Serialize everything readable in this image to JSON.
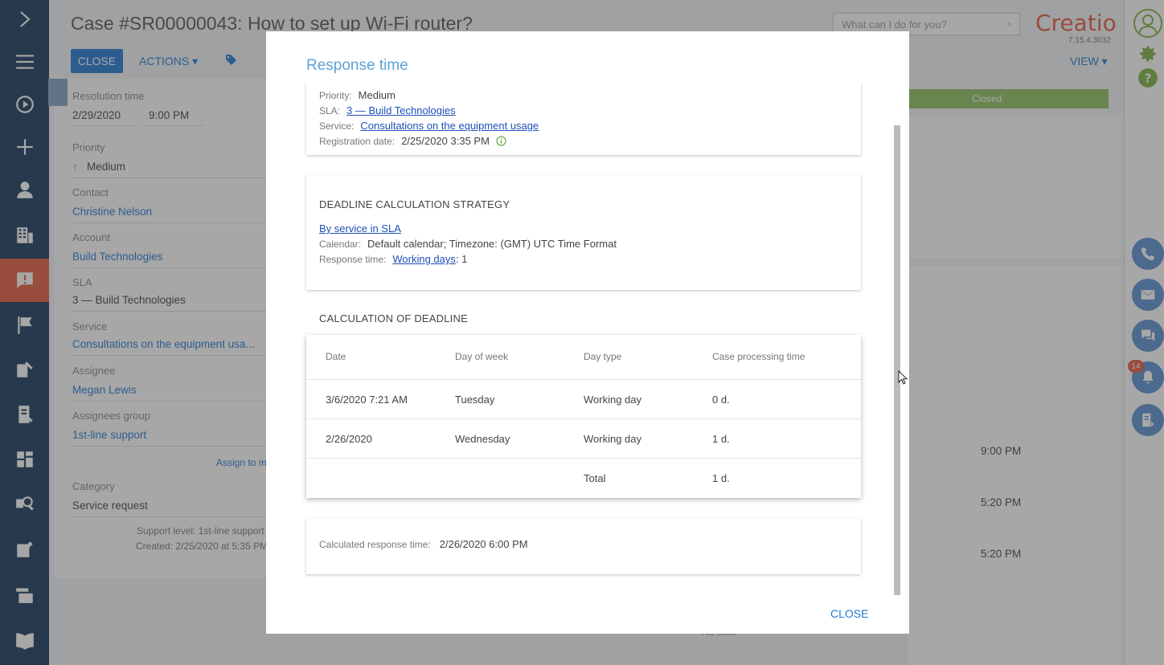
{
  "page": {
    "title": "Case #SR00000043: How to set up Wi-Fi router?",
    "close_label": "CLOSE",
    "actions_label": "ACTIONS",
    "view_label": "VIEW",
    "search_placeholder": "What can I do for you?",
    "logo": "Creatio",
    "version": "7.15.4.3032",
    "stage": "Closed",
    "assign_to_me": "Assign to me",
    "support_level": "Support level: 1st-line support",
    "created": "Created: 2/25/2020 at 5:35 PM",
    "bg_times": [
      "9:00 PM",
      "5:20 PM",
      "5:20 PM"
    ],
    "no_data": "No data"
  },
  "fields": {
    "resolution_time_label": "Resolution time",
    "resolution_date": "2/29/2020",
    "resolution_time": "9:00 PM",
    "priority_label": "Priority",
    "priority": "Medium",
    "contact_label": "Contact",
    "contact": "Christine Nelson",
    "account_label": "Account",
    "account": "Build Technologies",
    "sla_label": "SLA",
    "sla": "3 — Build Technologies",
    "service_label": "Service",
    "service": "Consultations on the equipment usa...",
    "assignee_label": "Assignee",
    "assignee": "Megan Lewis",
    "assignees_group_label": "Assignees group",
    "assignees_group": "1st-line support",
    "category_label": "Category",
    "category": "Service request"
  },
  "rightbar": {
    "notification_count": "14"
  },
  "modal": {
    "title": "Response time",
    "info": {
      "priority_label": "Priority:",
      "priority": "Medium",
      "sla_label": "SLA:",
      "sla": "3 — Build Technologies",
      "service_label": "Service:",
      "service": "Consultations on the equipment usage",
      "registration_label": "Registration date:",
      "registration": "2/25/2020 3:35 PM"
    },
    "strategy": {
      "heading": "DEADLINE CALCULATION STRATEGY",
      "link": "By service in SLA",
      "calendar_label": "Calendar:",
      "calendar": "Default calendar; Timezone: (GMT) UTC Time Format",
      "response_label": "Response time:",
      "response_link": "Working days",
      "response_value": ": 1"
    },
    "calc_heading": "CALCULATION OF DEADLINE",
    "table": {
      "headers": [
        "Date",
        "Day of week",
        "Day type",
        "Case processing time"
      ],
      "rows": [
        [
          "3/6/2020 7:21 AM",
          "Tuesday",
          "Working day",
          "0 d."
        ],
        [
          "2/26/2020",
          "Wednesday",
          "Working day",
          "1 d."
        ],
        [
          "",
          "",
          "Total",
          "1 d."
        ]
      ]
    },
    "calculated_label": "Calculated response time:",
    "calculated_value": "2/26/2020 6:00 PM",
    "close_label": "CLOSE"
  }
}
